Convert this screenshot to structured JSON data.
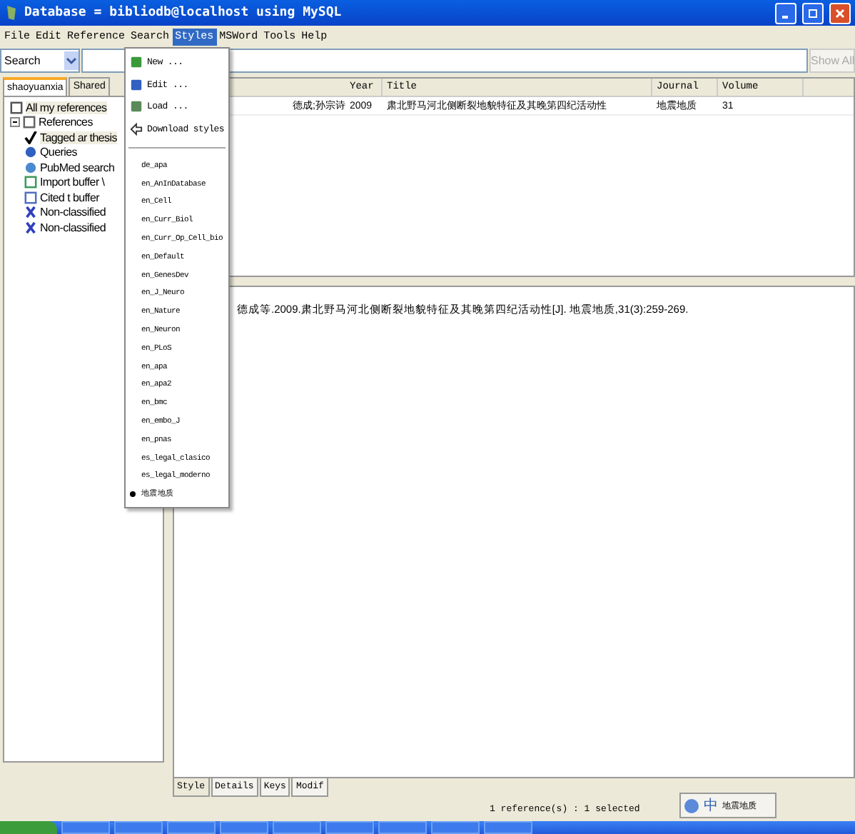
{
  "window": {
    "title": "Database = bibliodb@localhost using MySQL"
  },
  "menu_bar": [
    {
      "label": "File",
      "selected": false
    },
    {
      "label": "Edit",
      "selected": false
    },
    {
      "label": "Reference",
      "selected": false
    },
    {
      "label": "Search",
      "selected": false
    },
    {
      "label": "Styles",
      "selected": true
    },
    {
      "label": "MSWord",
      "selected": false
    },
    {
      "label": "Tools",
      "selected": false
    },
    {
      "label": "Help",
      "selected": false
    }
  ],
  "search": {
    "value": "Search",
    "button": "Show All"
  },
  "sidebar": {
    "tabs": [
      {
        "label": "shaoyuanxia",
        "selected": true
      },
      {
        "label": "Shared",
        "selected": false
      }
    ],
    "items": [
      {
        "label": "All my references",
        "selected": true
      },
      {
        "label": "References",
        "selected": false,
        "children": [
          {
            "label": "Tagged ar thesis",
            "selected": true
          },
          {
            "label": "Queries",
            "selected": false
          },
          {
            "label": "PubMed search",
            "selected": false
          },
          {
            "label": "Import buffer \\",
            "selected": false
          },
          {
            "label": "Cited t buffer",
            "selected": false
          },
          {
            "label": "Non-classified",
            "selected": false
          },
          {
            "label": "Non-classified",
            "selected": false
          }
        ]
      }
    ]
  },
  "table": {
    "columns": [
      "Year",
      "Title",
      "Journal",
      "Volume"
    ],
    "rows": [
      {
        "author": "德成;孙宗诗",
        "year": "2009",
        "title": "肃北野马河北侧断裂地貌特征及其晚第四纪活动性",
        "journal": "地震地质",
        "volume": "31"
      }
    ]
  },
  "preview": {
    "text": "德成等.2009.肃北野马河北侧断裂地貌特征及其晚第四纪活动性[J]. 地震地质,31(3):259-269."
  },
  "bottom_tabs": [
    {
      "label": "Style",
      "selected": true
    },
    {
      "label": "Details",
      "selected": false
    },
    {
      "label": "Keys",
      "selected": false
    },
    {
      "label": "Modif",
      "selected": false
    }
  ],
  "status_bar": "1 reference(s) : 1 selected",
  "ime": {
    "label": "中",
    "extra": "地震地质"
  },
  "styles_menu": {
    "actions": [
      {
        "label": "New ..."
      },
      {
        "label": "Edit ..."
      },
      {
        "label": "Load ..."
      },
      {
        "label": "Download styles"
      }
    ],
    "styles": [
      {
        "label": "de_apa",
        "checked": false
      },
      {
        "label": "en_AnInDatabase",
        "checked": false
      },
      {
        "label": "en_Cell",
        "checked": false
      },
      {
        "label": "en_Curr_Biol",
        "checked": false
      },
      {
        "label": "en_Curr_Op_Cell_bio",
        "checked": false
      },
      {
        "label": "en_Default",
        "checked": false
      },
      {
        "label": "en_GenesDev",
        "checked": false
      },
      {
        "label": "en_J_Neuro",
        "checked": false
      },
      {
        "label": "en_Nature",
        "checked": false
      },
      {
        "label": "en_Neuron",
        "checked": false
      },
      {
        "label": "en_PLoS",
        "checked": false
      },
      {
        "label": "en_apa",
        "checked": false
      },
      {
        "label": "en_apa2",
        "checked": false
      },
      {
        "label": "en_bmc",
        "checked": false
      },
      {
        "label": "en_embo_J",
        "checked": false
      },
      {
        "label": "en_pnas",
        "checked": false
      },
      {
        "label": "es_legal_clasico",
        "checked": false
      },
      {
        "label": "es_legal_moderno",
        "checked": false
      },
      {
        "label": "地震地质",
        "checked": true
      }
    ]
  }
}
